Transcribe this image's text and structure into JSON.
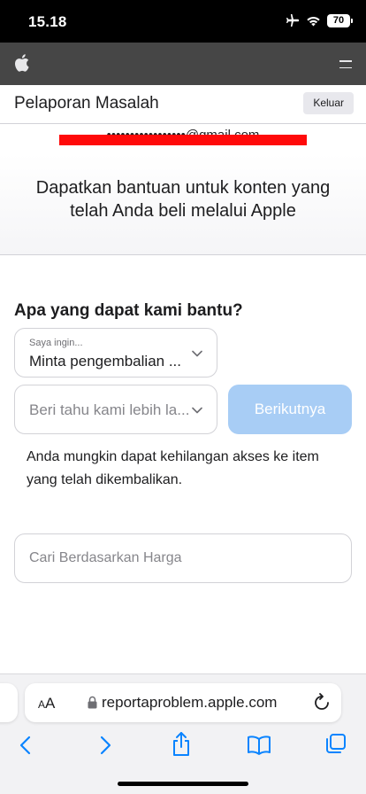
{
  "status_bar": {
    "time": "15.18",
    "battery": "70"
  },
  "local_nav": {
    "title": "Pelaporan Masalah",
    "logout_label": "Keluar"
  },
  "account": {
    "email": "•••••••••••••••••@gmail.com"
  },
  "hero": {
    "title": "Dapatkan bantuan untuk konten yang telah Anda beli melalui Apple"
  },
  "form": {
    "question": "Apa yang dapat kami bantu?",
    "request_select": {
      "label": "Saya ingin...",
      "value": "Minta pengembalian ..."
    },
    "detail_select": {
      "placeholder": "Beri tahu kami lebih la..."
    },
    "next_label": "Berikutnya",
    "info": "Anda mungkin dapat kehilangan akses ke item yang telah dikembalikan.",
    "search_placeholder": "Cari Berdasarkan Harga"
  },
  "safari": {
    "aa_label": "AA",
    "url": "reportaproblem.apple.com"
  },
  "colors": {
    "accent_disabled": "#a8cdf5",
    "nav_bg": "#464646",
    "redaction": "#ff0a0a",
    "safari_blue": "#0a84ff"
  },
  "icons": [
    "airplane-icon",
    "wifi-icon",
    "battery-icon",
    "apple-logo-icon",
    "menu-icon",
    "chevron-down-icon",
    "lock-icon",
    "reload-icon",
    "back-icon",
    "forward-icon",
    "share-icon",
    "bookmarks-icon",
    "tabs-icon"
  ]
}
